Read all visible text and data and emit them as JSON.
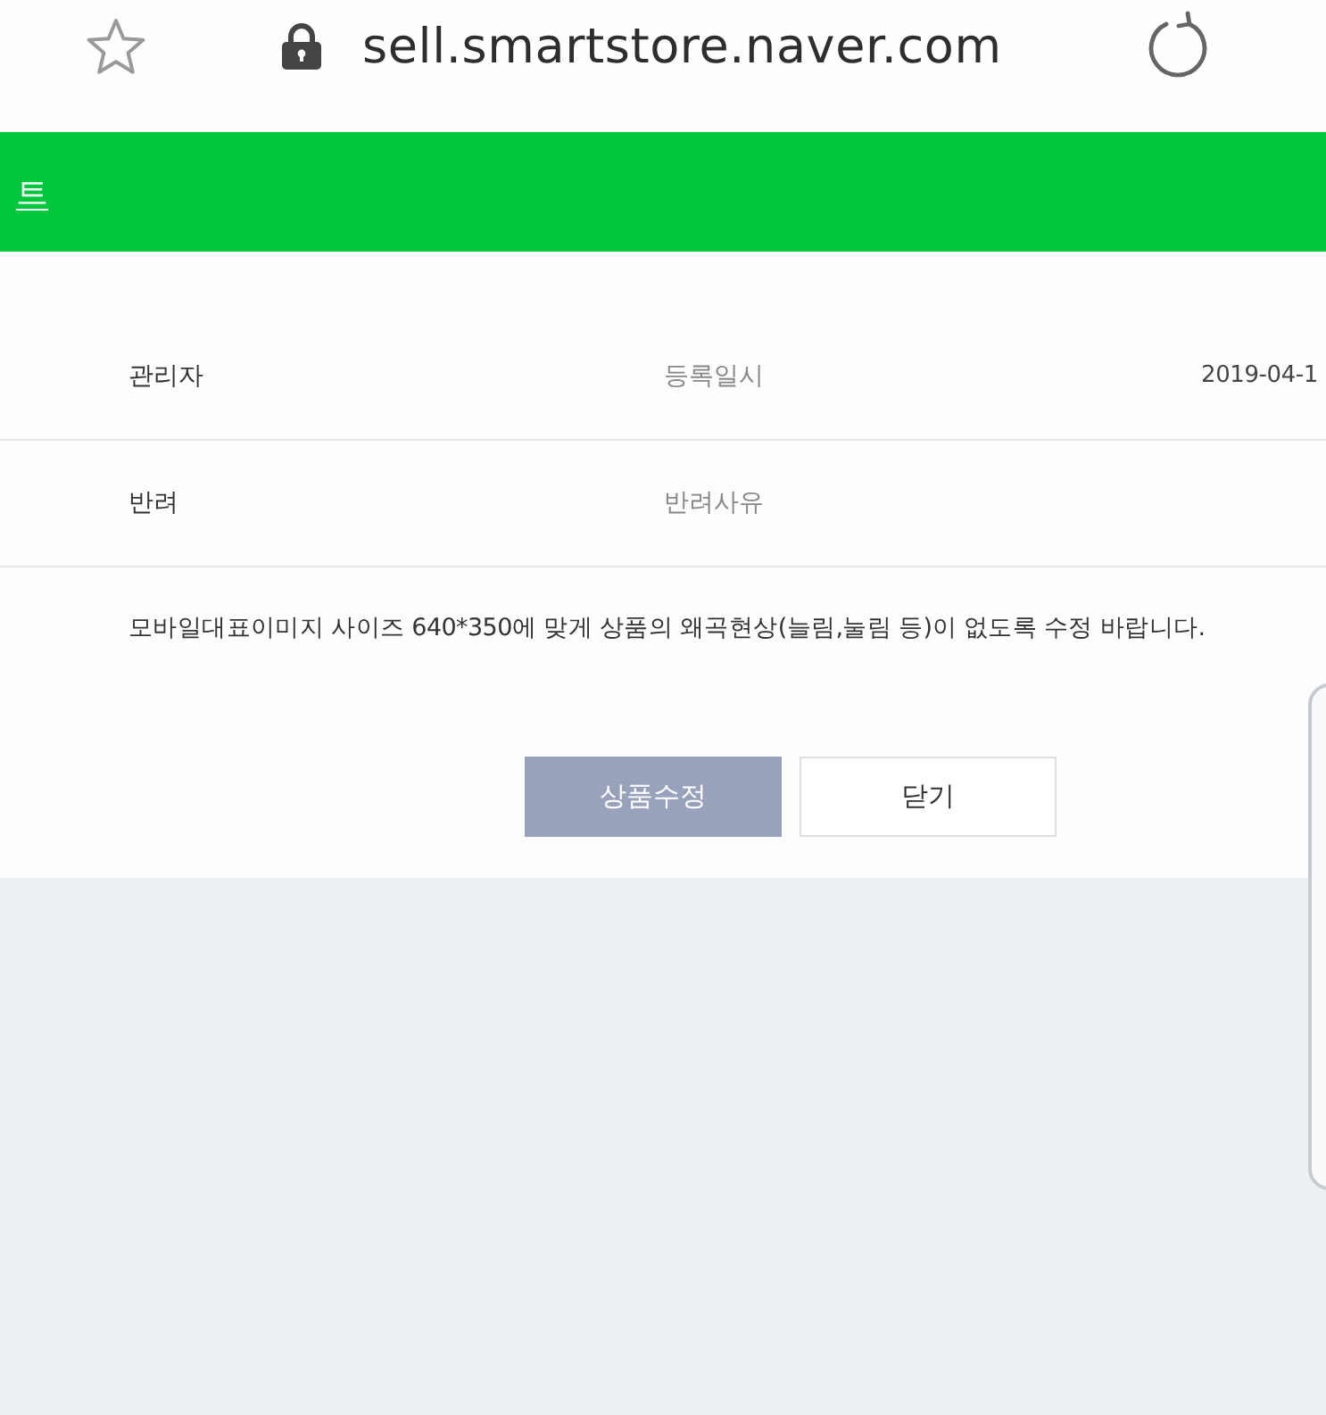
{
  "browser_bar": {
    "url": "sell.smartstore.naver.com"
  },
  "header": {
    "title": "트"
  },
  "details": {
    "rows": [
      {
        "label": "관리자",
        "field_label": "등록일시",
        "value": "2019-04-1"
      },
      {
        "label": "반려",
        "field_label": "반려사유"
      }
    ]
  },
  "message": "모바일대표이미지 사이즈 640*350에 맞게 상품의 왜곡현상(늘림,눌림 등)이 없도록 수정 바랍니다.",
  "buttons": [
    {
      "label": "상품수정",
      "kind": "primary"
    },
    {
      "label": "닫기",
      "kind": "secondary"
    }
  ]
}
